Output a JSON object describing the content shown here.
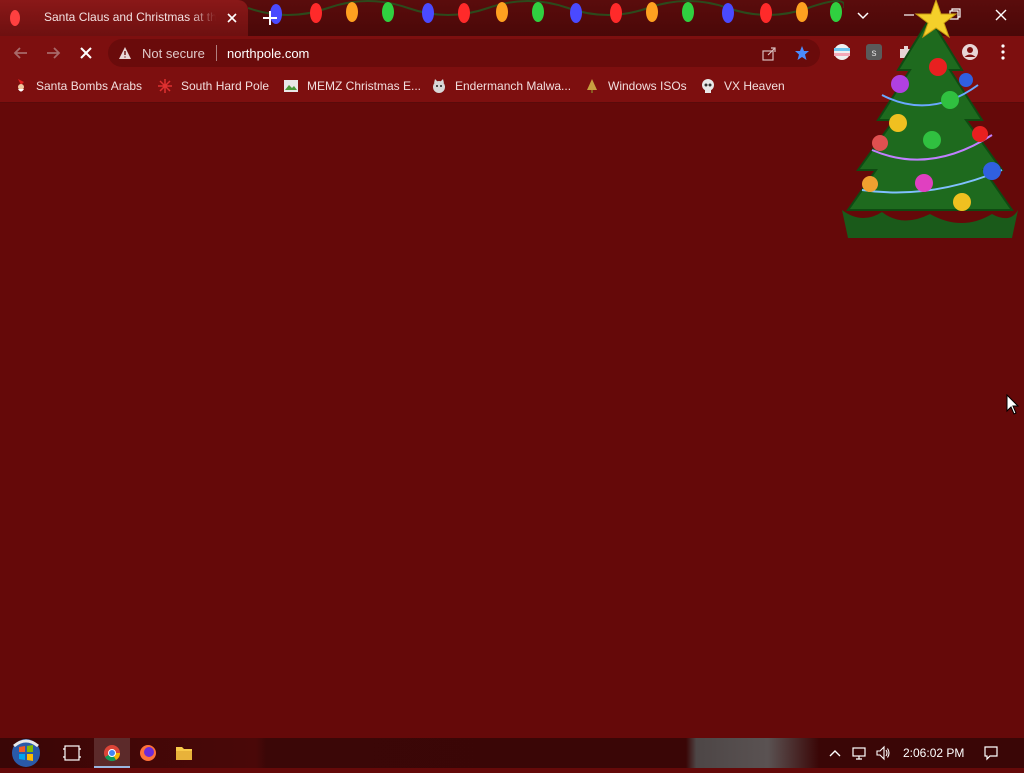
{
  "tab": {
    "title": "Santa Claus and Christmas at the North Pole"
  },
  "address_bar": {
    "security_label": "Not secure",
    "url": "northpole.com"
  },
  "bookmarks": [
    {
      "label": "Santa Bombs Arabs",
      "icon": "santa-icon"
    },
    {
      "label": "South Hard Pole",
      "icon": "snowflake-icon"
    },
    {
      "label": "MEMZ Christmas E...",
      "icon": "image-icon"
    },
    {
      "label": "Endermanch Malwa...",
      "icon": "cat-icon"
    },
    {
      "label": "Windows ISOs",
      "icon": "tree-icon"
    },
    {
      "label": "VX Heaven",
      "icon": "skull-icon"
    }
  ],
  "taskbar": {
    "clock": "2:06:02 PM"
  },
  "colors": {
    "page_bg": "#650909",
    "toolbar_bg": "#7d0f0f",
    "bookmark_star": "#4a8cff"
  }
}
